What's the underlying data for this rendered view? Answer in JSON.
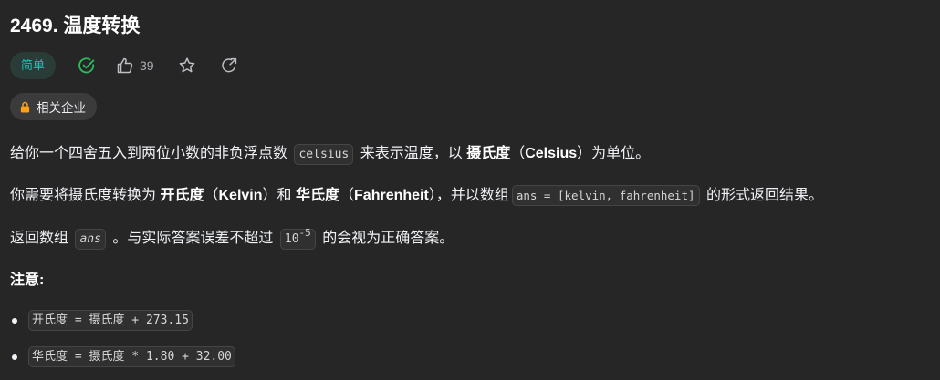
{
  "problem": {
    "title": "2469. 温度转换",
    "difficulty": "简单",
    "likes": "39",
    "company_tag": "相关企业"
  },
  "description": {
    "p1": {
      "t1": "给你一个四舍五入到两位小数的非负浮点数",
      "code1": "celsius",
      "t2": "来表示温度，以",
      "b1": "摄氏度",
      "t3": "（",
      "b2": "Celsius",
      "t4": "）为单位。"
    },
    "p2": {
      "t1": "你需要将摄氏度转换为",
      "b1": "开氏度",
      "t2": "（",
      "b2": "Kelvin",
      "t3": "）和",
      "b3": "华氏度",
      "t4": "（",
      "b4": "Fahrenheit",
      "t5": "），并以数组",
      "code1": "ans = [kelvin, fahrenheit]",
      "t6": "的形式返回结果。"
    },
    "p3": {
      "t1": "返回数组",
      "code1": "ans",
      "t2": "。与实际答案误差不超过",
      "code2_base": "10",
      "code2_exp": "-5",
      "t3": "的会视为正确答案。"
    },
    "notes_title": "注意:",
    "notes": [
      "开氏度 = 摄氏度 + 273.15",
      "华氏度 = 摄氏度 * 1.80 + 32.00"
    ]
  },
  "icons": {
    "solved": "check-circle-icon",
    "like": "thumbs-up-icon",
    "star": "star-icon",
    "share": "share-icon",
    "lock": "lock-icon"
  },
  "colors": {
    "background": "#262626",
    "difficulty_easy": "#1cc0b4",
    "solved_green": "#2cbb5d",
    "lock_orange": "#ffa116"
  }
}
